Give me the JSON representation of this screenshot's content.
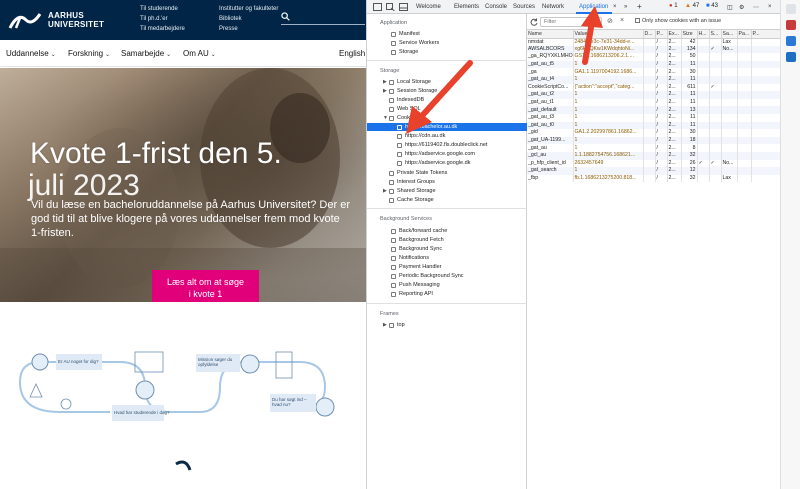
{
  "site": {
    "logo_line1": "AARHUS",
    "logo_line2": "UNIVERSITET",
    "header_links_col1": [
      "Til studerende",
      "Til ph.d.'er",
      "Til medarbejdere"
    ],
    "header_links_col2": [
      "Institutter og fakulteter",
      "Bibliotek",
      "Presse"
    ],
    "nav": [
      "Uddannelse",
      "Forskning",
      "Samarbejde",
      "Om AU"
    ],
    "nav_lang": "English",
    "hero_title_a": "Kvote 1-frist den 5.",
    "hero_title_b": "juli 2023",
    "hero_body": "Vil du læse en bacheloruddannelse på Aarhus Universitet? Der er god tid til at blive klogere på vores uddannelser frem mod kvote 1-fristen.",
    "hero_cta_line1": "Læs alt om at søge",
    "hero_cta_line2": "i kvote 1",
    "illus_bubbles": [
      "Er AU noget for dig?",
      "Mission søger du opfyldelse",
      "Hvad har studerende i dag?",
      "Du har søgt ind – hvad nu?"
    ]
  },
  "devtools": {
    "tabs": [
      "Welcome",
      "Elements",
      "Console",
      "Sources",
      "Network",
      "Application"
    ],
    "active_tab": "Application",
    "more_tabs": "»",
    "plus": "+",
    "errors": "1",
    "warnings": "47",
    "info": "43",
    "sidebar": {
      "application_header": "Application",
      "application_items": [
        "Manifest",
        "Service Workers",
        "Storage"
      ],
      "storage_header": "Storage",
      "storage_items": [
        "Local Storage",
        "Session Storage",
        "IndexedDB",
        "Web SQL",
        "Cookies"
      ],
      "cookie_sites": [
        "https://bachelor.au.dk",
        "https://cdn.au.dk",
        "https://6119402.fls.doubleclick.net",
        "https://adservice.google.com",
        "https://adservice.google.dk"
      ],
      "storage_items_2": [
        "Private State Tokens",
        "Interest Groups",
        "Shared Storage",
        "Cache Storage"
      ],
      "background_header": "Background Services",
      "background_items": [
        "Back/forward cache",
        "Background Fetch",
        "Background Sync",
        "Notifications",
        "Payment Handler",
        "Periodic Background Sync",
        "Push Messaging",
        "Reporting API"
      ],
      "frames_header": "Frames",
      "frames_items": [
        "top"
      ]
    },
    "toolbar": {
      "filter_placeholder": "Filter",
      "only_issue_label": "Only show cookies with an issue"
    },
    "columns": [
      "Name",
      "Value",
      "D...",
      "P...",
      "Ex...",
      "Size",
      "H...",
      "S...",
      "Sa...",
      "Pa...",
      "P..."
    ],
    "rows": [
      [
        "nmstat",
        "2484-4e3c-7e31-34dd-e...",
        "",
        "/",
        "2...",
        "42",
        "",
        "",
        "Lax",
        "",
        ""
      ],
      [
        "AWSALBCORS",
        "xg6H3QKw1KWdqhtoNi...",
        "",
        "/",
        "2...",
        "134",
        "",
        "✓",
        "No...",
        "",
        ""
      ],
      [
        "_ga_RQYXKLMHO5",
        "GS1.1.1686213206.2.1....",
        "",
        "/",
        "2...",
        "50",
        "",
        "",
        "",
        "",
        ""
      ],
      [
        "_gat_au_t5",
        "1",
        "",
        "/",
        "2...",
        "11",
        "",
        "",
        "",
        "",
        ""
      ],
      [
        "_ga",
        "GA1.1.1197004192.1686...",
        "",
        "/",
        "2...",
        "30",
        "",
        "",
        "",
        "",
        ""
      ],
      [
        "_gat_au_t4",
        "1",
        "",
        "/",
        "2...",
        "11",
        "",
        "",
        "",
        "",
        ""
      ],
      [
        "CookieScriptCo...",
        "{\"action\":\"accept\",\"categ...",
        "",
        "/",
        "2...",
        "611",
        "",
        "✓",
        "",
        "",
        ""
      ],
      [
        "_gat_au_t2",
        "1",
        "",
        "/",
        "2...",
        "11",
        "",
        "",
        "",
        "",
        ""
      ],
      [
        "_gat_au_t1",
        "1",
        "",
        "/",
        "2...",
        "11",
        "",
        "",
        "",
        "",
        ""
      ],
      [
        "_gat_default",
        "1",
        "",
        "/",
        "2...",
        "13",
        "",
        "",
        "",
        "",
        ""
      ],
      [
        "_gat_au_t3",
        "1",
        "",
        "/",
        "2...",
        "11",
        "",
        "",
        "",
        "",
        ""
      ],
      [
        "_gat_au_t0",
        "1",
        "",
        "/",
        "2...",
        "11",
        "",
        "",
        "",
        "",
        ""
      ],
      [
        "_gid",
        "GA1.2.202997861.16862...",
        "",
        "/",
        "2...",
        "30",
        "",
        "",
        "",
        "",
        ""
      ],
      [
        "_gat_UA-1199...",
        "1",
        "",
        "/",
        "2...",
        "18",
        "",
        "",
        "",
        "",
        ""
      ],
      [
        "_gat_au",
        "1",
        "",
        "/",
        "2...",
        "8",
        "",
        "",
        "",
        "",
        ""
      ],
      [
        "_gcl_au",
        "1.1.1882754756.168621...",
        "",
        "/",
        "2...",
        "32",
        "",
        "",
        "",
        "",
        ""
      ],
      [
        "_p_hfp_client_id",
        "2632457649",
        "",
        "/",
        "2...",
        "26",
        "✓",
        "✓",
        "No...",
        "",
        ""
      ],
      [
        "_gat_search",
        "1",
        "",
        "/",
        "2...",
        "12",
        "",
        "",
        "",
        "",
        ""
      ],
      [
        "_fbp",
        "fb.1.1686213275200.818...",
        "",
        "/",
        "2...",
        "32",
        "",
        "",
        "Lax",
        "",
        ""
      ]
    ]
  },
  "colors": {
    "au_navy": "#002546",
    "cta_pink": "#e2007a",
    "devtools_blue": "#1a73e8",
    "annotation_red": "#e8412c"
  }
}
